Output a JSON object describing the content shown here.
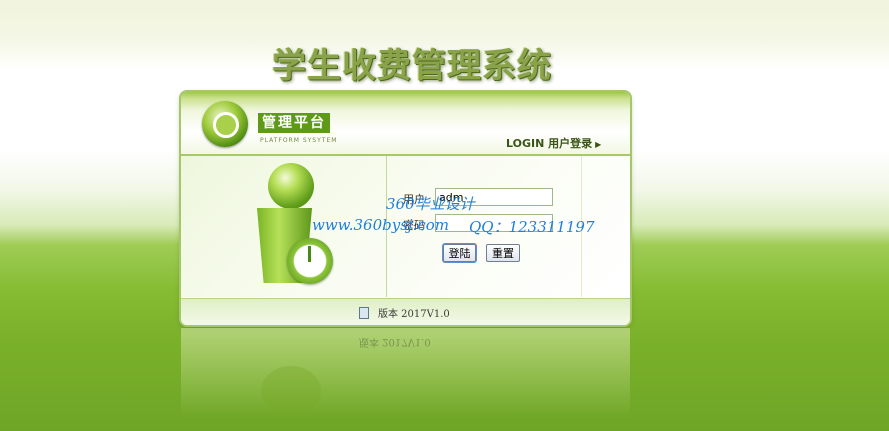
{
  "page": {
    "title": "学生收费管理系统"
  },
  "header": {
    "platform_title": "管理平台",
    "platform_subtitle": "PLATFORM SYSYTEM",
    "login_link": "LOGIN 用户登录",
    "login_arrow": "▶"
  },
  "form": {
    "username_label": "用户",
    "username_value": "adm",
    "password_label": "密码",
    "password_value": "",
    "login_button": "登陆",
    "reset_button": "重置"
  },
  "footer": {
    "version": "版本 2017V1.0"
  },
  "watermark": {
    "line1": "360毕业设计",
    "line2_site": "www.360bysj.com",
    "line2_qq": "QQ：123311197"
  },
  "reflection": {
    "text": "版本 2017V1.0"
  },
  "icons": {
    "logo": "clock-logo-icon",
    "figure": "user-clock-icon",
    "doc": "document-icon"
  },
  "colors": {
    "accent_green": "#5e9a18",
    "watermark_blue": "#1f7fd9",
    "title_green": "#8aa24a"
  }
}
